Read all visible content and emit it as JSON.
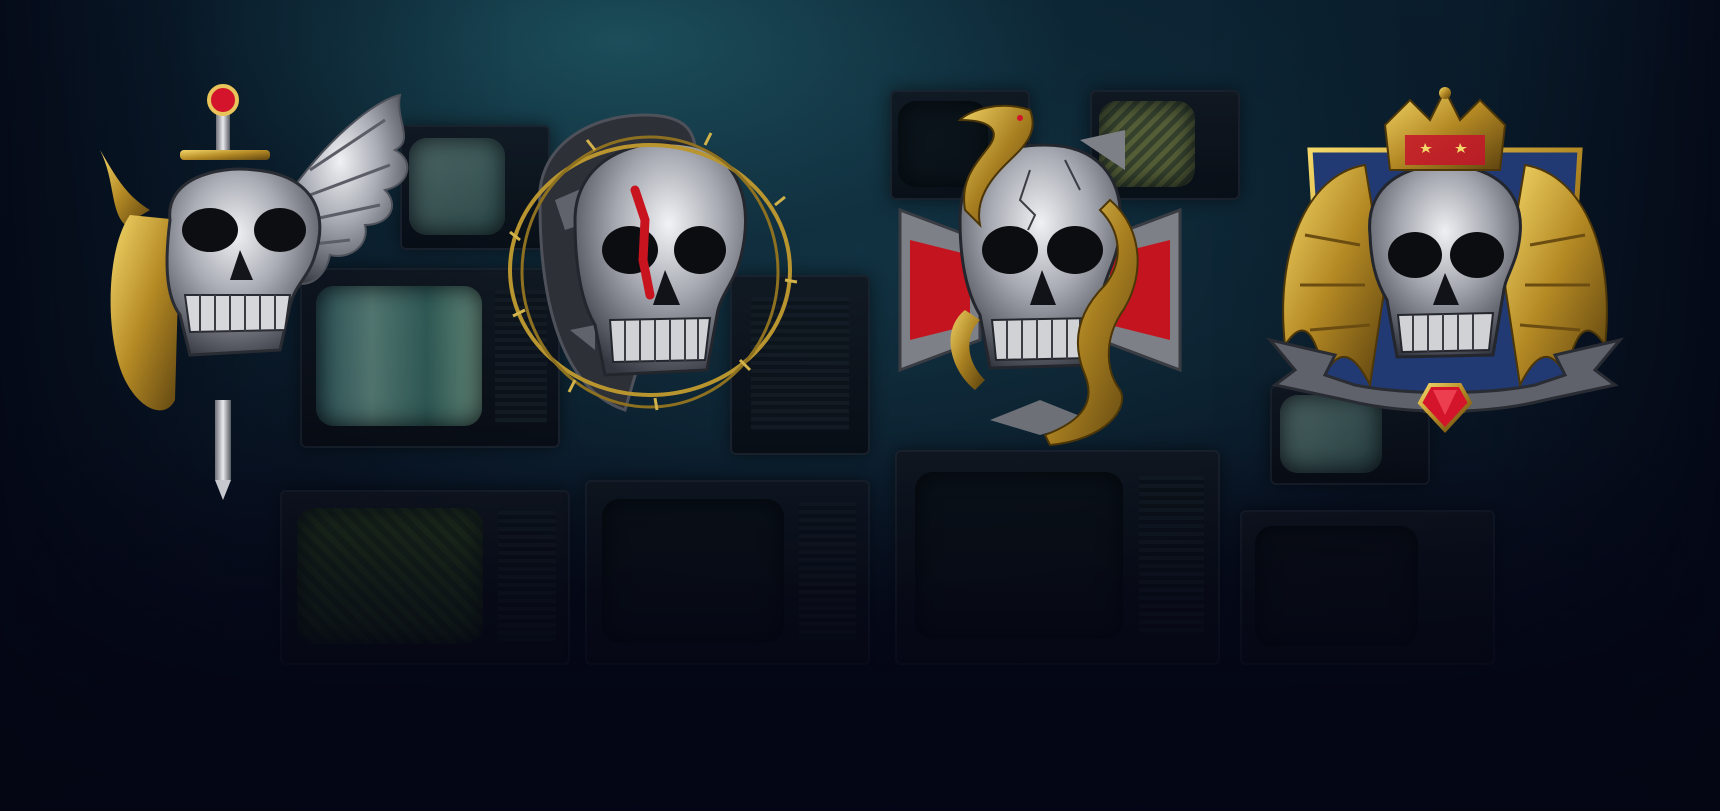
{
  "scene": {
    "background": "dark-wall-of-crt-televisions",
    "accent_colors": {
      "silver": "#c9cbd0",
      "gold": "#c9a437",
      "ruby": "#d3142a",
      "teal": "#2b6d78"
    }
  },
  "emblems": [
    {
      "name": "skull-dagger-wing-emblem",
      "icons": [
        "skull-icon",
        "dagger-icon",
        "wing-icon",
        "horned-gold-mask-icon"
      ]
    },
    {
      "name": "skull-barbed-wire-emblem",
      "icons": [
        "skull-icon",
        "barbed-wire-icon",
        "cracked-stone-icon"
      ]
    },
    {
      "name": "skull-dragon-cross-emblem",
      "icons": [
        "skull-icon",
        "dragon-icon",
        "iron-cross-icon"
      ]
    },
    {
      "name": "skull-crown-wings-emblem",
      "icons": [
        "skull-icon",
        "crown-icon",
        "gold-wings-icon",
        "ribbon-banner-icon",
        "ruby-gem-icon"
      ]
    }
  ]
}
